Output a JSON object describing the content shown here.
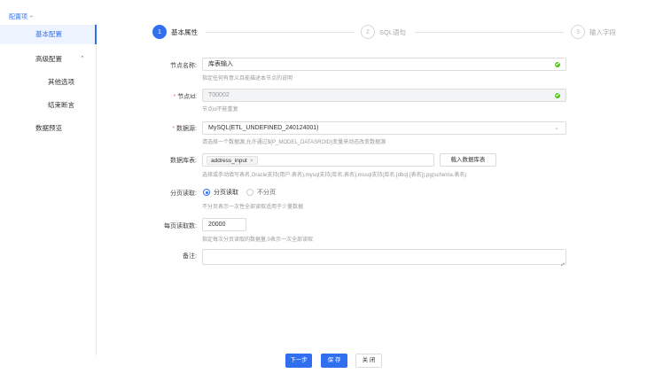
{
  "sidebar": {
    "header": "配置项",
    "header_icon": "collapse-icon",
    "items": [
      {
        "label": "基本配置",
        "active": true
      },
      {
        "label": "高级配置",
        "expandable": true
      },
      {
        "label": "其他选项"
      },
      {
        "label": "结束断言"
      },
      {
        "label": "数据预览"
      }
    ]
  },
  "steps": [
    {
      "num": "1",
      "label": "基本属性",
      "active": true
    },
    {
      "num": "2",
      "label": "SQL语句",
      "active": false
    },
    {
      "num": "3",
      "label": "输入字段",
      "active": false
    }
  ],
  "form": {
    "node_name": {
      "label": "节点名称:",
      "value": "库表输入",
      "hint": "指定任何有意义且能描述本节点的说明"
    },
    "node_id": {
      "label": "节点Id:",
      "value": "T00002",
      "hint": "节点id不能重复"
    },
    "datasource": {
      "label": "数据源:",
      "value": "MySQL(ETL_UNDEFINED_240124001)",
      "hint": "请选择一个数据源,允许通过${P_MODEL_DATASROID}变量来动态改变数据源"
    },
    "tables": {
      "label": "数据库表:",
      "tag": "address_input",
      "load_button": "载入数据库表",
      "hint": "选择或手动填写表名,Oracle支持(用户.表名),mysql支持(库名.表名),mssql支持(库名.[dbo].[表名]),pg(schema.表名)"
    },
    "paging": {
      "label": "分页读取:",
      "option_on": "分页读取",
      "option_off": "不分页",
      "hint": "不分页表示一次性全部读取适用于少量数据"
    },
    "page_size": {
      "label": "每页读取数:",
      "value": "20000",
      "hint": "指定每次分页读取的数据量,0表示一次全部读取"
    },
    "remark": {
      "label": "备注:",
      "value": ""
    }
  },
  "footer": {
    "next": "下一步",
    "save": "保 存",
    "close": "关 闭"
  },
  "colors": {
    "accent": "#2f6ff0",
    "success": "#52c41a",
    "required": "#f56c6c"
  }
}
